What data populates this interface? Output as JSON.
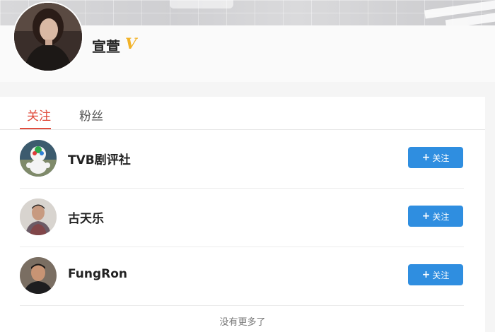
{
  "profile": {
    "name": "宣萱",
    "verified_mark": "V"
  },
  "tabs": [
    {
      "label": "关注",
      "active": true
    },
    {
      "label": "粉丝",
      "active": false
    }
  ],
  "following": [
    {
      "name": "TVB剧评社",
      "button_label": "关注"
    },
    {
      "name": "古天乐",
      "button_label": "关注"
    },
    {
      "name": "FungRon",
      "button_label": "关注"
    }
  ],
  "footer": {
    "no_more": "没有更多了"
  },
  "icons": {
    "plus": "+"
  },
  "colors": {
    "accent_red": "#e04b3c",
    "button_blue": "#2f8ee0",
    "verified_gold": "#f2b227"
  }
}
